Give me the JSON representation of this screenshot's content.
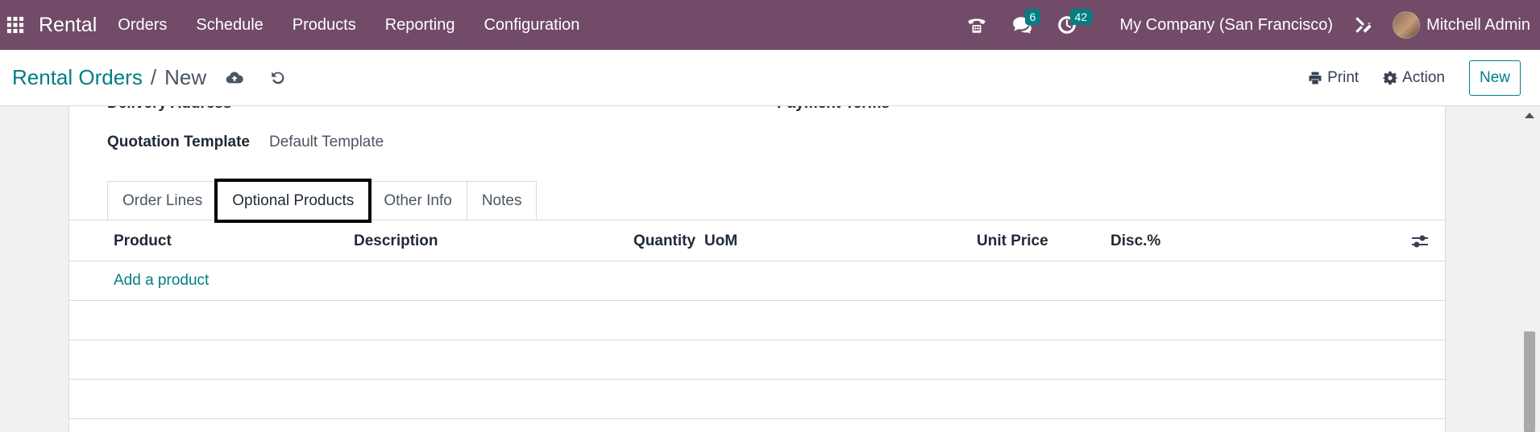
{
  "topbar": {
    "app_name": "Rental",
    "menu": [
      "Orders",
      "Schedule",
      "Products",
      "Reporting",
      "Configuration"
    ],
    "messages_count": "6",
    "activities_count": "42",
    "company": "My Company (San Francisco)",
    "user": "Mitchell Admin"
  },
  "controlbar": {
    "breadcrumb_parent": "Rental Orders",
    "breadcrumb_sep": "/",
    "breadcrumb_current": "New",
    "print_label": "Print",
    "action_label": "Action",
    "new_label": "New"
  },
  "form": {
    "delivery_address_label": "Delivery Address",
    "payment_terms_label": "Payment Terms",
    "quotation_template_label": "Quotation Template",
    "quotation_template_value": "Default Template"
  },
  "tabs": [
    "Order Lines",
    "Optional Products",
    "Other Info",
    "Notes"
  ],
  "table": {
    "columns": [
      "Product",
      "Description",
      "Quantity",
      "UoM",
      "Unit Price",
      "Disc.%"
    ],
    "add_product_label": "Add a product"
  },
  "colors": {
    "topbar": "#714b67",
    "accent": "#017e84"
  }
}
